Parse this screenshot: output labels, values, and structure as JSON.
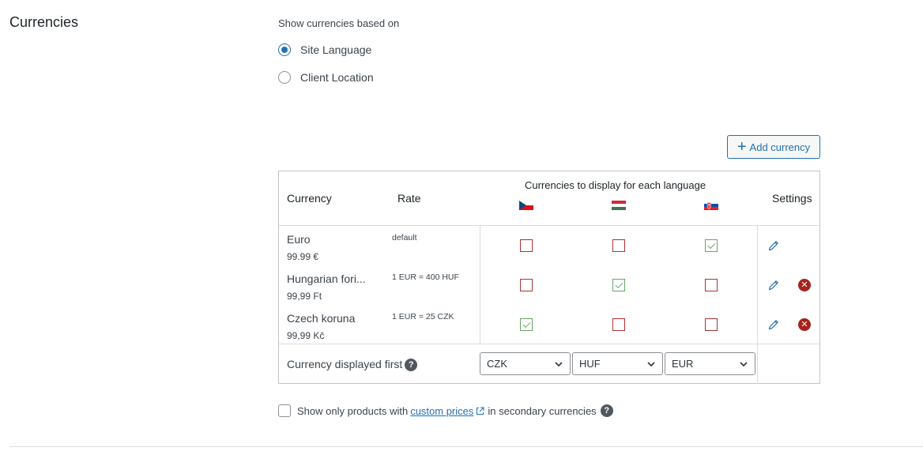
{
  "section": {
    "title": "Currencies"
  },
  "mode": {
    "label": "Show currencies based on",
    "options": [
      {
        "label": "Site Language",
        "checked": true
      },
      {
        "label": "Client Location",
        "checked": false
      }
    ]
  },
  "add_button": {
    "label": "Add currency"
  },
  "table": {
    "headers": {
      "currency": "Currency",
      "rate": "Rate",
      "per_language": "Currencies to display for each language",
      "settings": "Settings"
    },
    "languages": [
      {
        "flag": "czech-flag-icon"
      },
      {
        "flag": "hungary-flag-icon"
      },
      {
        "flag": "slovakia-flag-icon"
      }
    ],
    "rows": [
      {
        "name": "Euro",
        "price": "99.99 €",
        "rate": "default",
        "display": [
          false,
          false,
          true
        ],
        "deletable": false
      },
      {
        "name": "Hungarian fori...",
        "price": "99,99 Ft",
        "rate": "1 EUR = 400 HUF",
        "display": [
          false,
          true,
          false
        ],
        "deletable": true
      },
      {
        "name": "Czech koruna",
        "price": "99,99 Kč",
        "rate": "1 EUR = 25 CZK",
        "display": [
          true,
          false,
          false
        ],
        "deletable": true
      }
    ],
    "first": {
      "label": "Currency displayed first",
      "selects": [
        "CZK",
        "HUF",
        "EUR"
      ]
    }
  },
  "only_products": {
    "before": "Show only products with",
    "link": "custom prices",
    "after": "in secondary currencies"
  },
  "colors": {
    "accent": "#2271b1",
    "unchecked_border": "#aa3333",
    "checked_green": "#68a368",
    "delete_red": "#a5231b"
  }
}
